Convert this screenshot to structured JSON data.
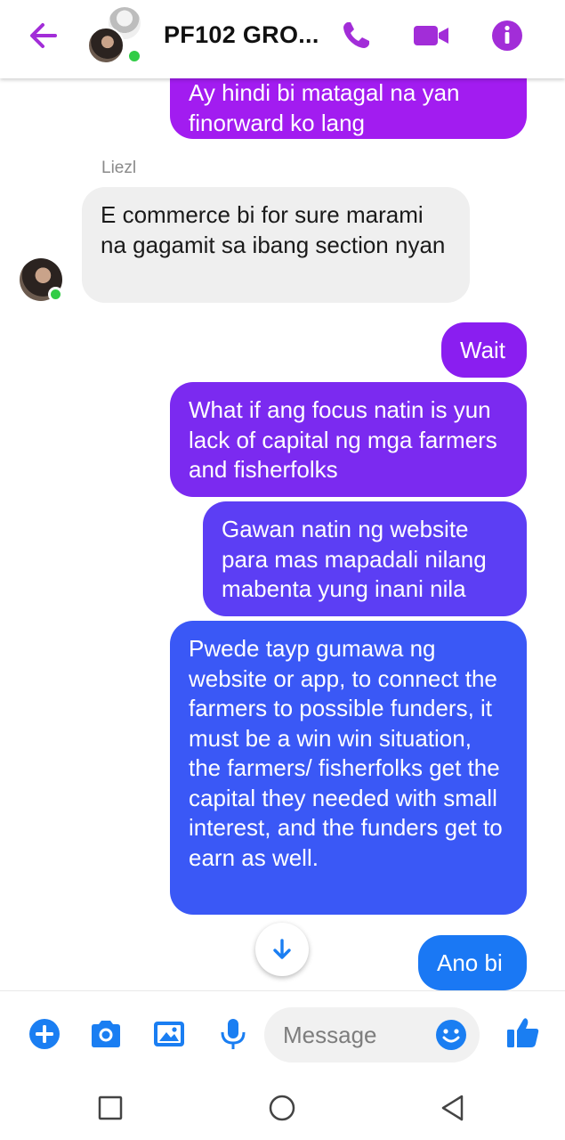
{
  "header": {
    "title": "PF102 GRO...",
    "icon_color": "#a22dd8"
  },
  "messages": [
    {
      "id": "m0",
      "direction": "out",
      "text": "Ay hindi bi matagal na yan finorward ko lang",
      "color": "#a21cf0"
    },
    {
      "id": "m1",
      "direction": "in",
      "sender": "Liezl",
      "text": "E commerce bi for sure marami na gagamit sa ibang section nyan"
    },
    {
      "id": "m2",
      "direction": "out",
      "text": "Wait",
      "color": "#8a1ef0"
    },
    {
      "id": "m3",
      "direction": "out",
      "text": "What if ang focus natin is yun lack of capital ng mga farmers and fisherfolks",
      "color": "#7b2af0"
    },
    {
      "id": "m4",
      "direction": "out",
      "text": "Gawan natin ng website para mas mapadali nilang mabenta yung inani nila",
      "color": "#5c3ef4"
    },
    {
      "id": "m5",
      "direction": "out",
      "text": "Pwede tayp gumawa ng website or app, to connect the farmers to possible funders, it must be a win win situation, the farmers/ fisherfolks get the capital they needed with small interest, and the funders get to earn as well.",
      "color": "#3a58f6"
    },
    {
      "id": "m6",
      "direction": "out",
      "text": "Ano bi",
      "color": "#1a78f4"
    }
  ],
  "composer": {
    "placeholder": "Message",
    "accent_color": "#1a7ef2"
  },
  "icons": {
    "back": "arrow-left-icon",
    "phone": "phone-icon",
    "video": "video-camera-icon",
    "info": "info-icon",
    "scroll": "arrow-down-icon",
    "plus": "plus-circle-icon",
    "camera": "camera-icon",
    "gallery": "image-icon",
    "mic": "microphone-icon",
    "emoji": "smiley-icon",
    "like": "thumbs-up-icon"
  }
}
